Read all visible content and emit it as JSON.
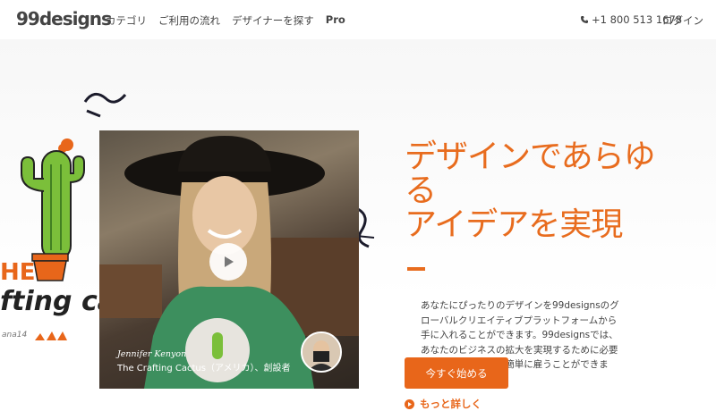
{
  "header": {
    "logo": "99designs",
    "nav": [
      "カテゴリ",
      "ご利用の流れ",
      "デザイナーを探す",
      "Pro"
    ],
    "phone": "+1 800 513 1678",
    "login": "ログイン"
  },
  "hero": {
    "headline_lines": [
      "デザインであらゆ",
      "る",
      "アイデアを実現"
    ],
    "description": "あなたにぴったりのデザインを99designsのグローバルクリエイティブプラットフォームから手に入れることができます。99designsでは、あなたのビジネスの拡大を実現するために必要なプロデザイナーを簡単に雇うことができます。",
    "cta_label": "今すぐ始める",
    "more_label": "もっと詳しく"
  },
  "video": {
    "person_name": "Jennifer Kenyon",
    "company": "The Crafting Cactus（アメリカ）、創設者"
  },
  "background_art": {
    "sign_line1": "HE",
    "sign_line2": "fting cac",
    "credit": "ana14"
  },
  "colors": {
    "accent": "#e86c1e",
    "button": "#e8661a",
    "text": "#444444"
  },
  "icons": [
    "phone-icon",
    "play-icon",
    "play-circle-icon",
    "cactus-illustration-icon"
  ]
}
